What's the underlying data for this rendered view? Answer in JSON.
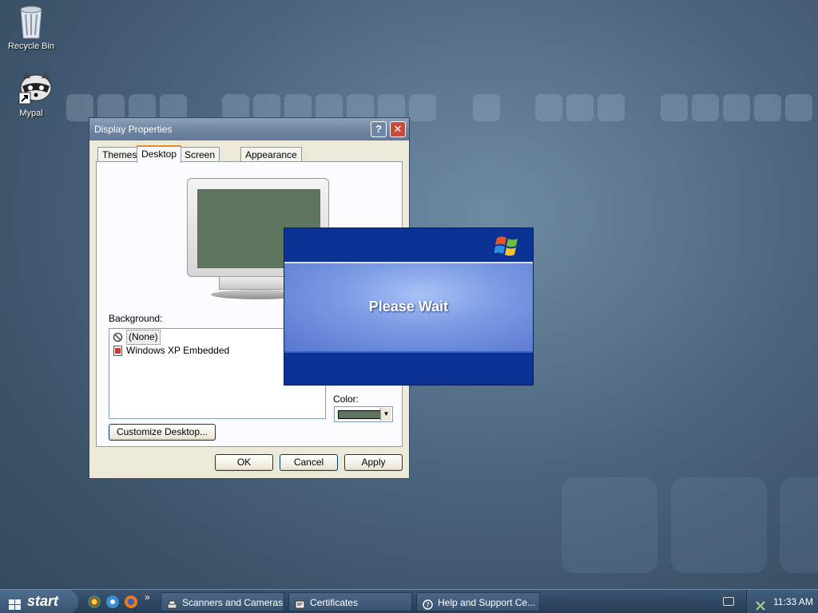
{
  "desktop": {
    "icons": [
      {
        "label": "Recycle Bin"
      },
      {
        "label": "Mypal"
      }
    ]
  },
  "window": {
    "title": "Display Properties",
    "help_glyph": "?",
    "close_glyph": "✕",
    "tabs": [
      {
        "label": "Themes"
      },
      {
        "label": "Desktop"
      },
      {
        "label": "Screen Saver"
      },
      {
        "label": "Appearance"
      }
    ],
    "active_tab": "Desktop",
    "background_label": "Background:",
    "backgrounds": [
      {
        "label": "(None)"
      },
      {
        "label": "Windows XP Embedded"
      }
    ],
    "selected_background": "(None)",
    "color_label": "Color:",
    "color_value": "#5e765f",
    "customize_label": "Customize Desktop...",
    "ok_label": "OK",
    "cancel_label": "Cancel",
    "apply_label": "Apply"
  },
  "splash": {
    "message": "Please Wait"
  },
  "taskbar": {
    "start_label": "start",
    "more_glyph": "»",
    "tasks": [
      {
        "label": "Scanners and Cameras",
        "icon": "scanner-icon"
      },
      {
        "label": "Certificates",
        "icon": "certificate-icon"
      },
      {
        "label": "Help and Support Ce...",
        "icon": "help-icon"
      }
    ],
    "clock": "11:33 AM"
  }
}
